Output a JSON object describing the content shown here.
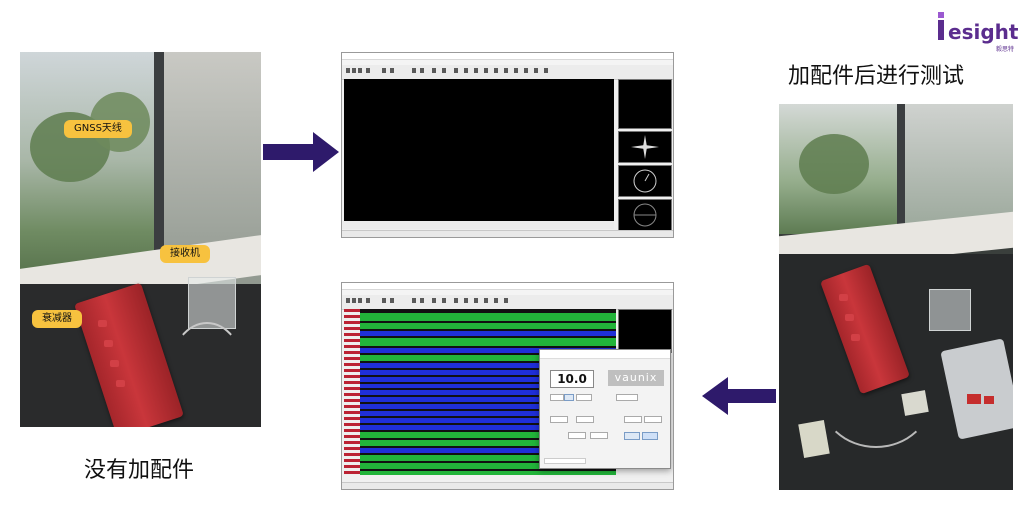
{
  "logo": {
    "text": "esight",
    "sub": "毅思特"
  },
  "labels": {
    "gnss_antenna": "GNSS天线",
    "receiver": "接收机",
    "attenuator": "衰减器"
  },
  "captions": {
    "without_accessory": "没有加配件",
    "with_accessory_test": "加配件后进行测试"
  },
  "attenuator_dialog": {
    "value": "10.0",
    "brand": "vaunix"
  },
  "colors": {
    "arrow": "#2e1a6b",
    "label_bg": "#f7c23f",
    "stripe_green": "#22b43a",
    "stripe_blue": "#1f2fd8",
    "brand_purple": "#5b2d8e"
  }
}
